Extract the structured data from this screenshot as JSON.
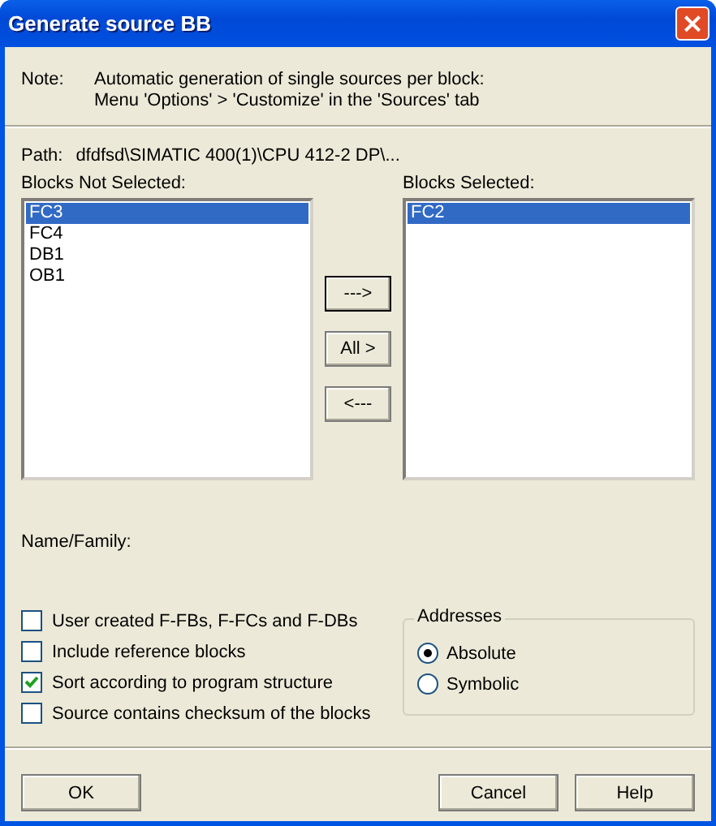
{
  "window": {
    "title": "Generate source BB",
    "close": "×"
  },
  "note": {
    "label": "Note:",
    "lines": [
      "Automatic generation of single sources per block:",
      "Menu 'Options' > 'Customize' in the 'Sources' tab"
    ]
  },
  "path": {
    "label": "Path:",
    "value": "dfdfsd\\SIMATIC 400(1)\\CPU 412-2 DP\\..."
  },
  "blocks_not_selected": {
    "label": "Blocks Not Selected:",
    "items": [
      {
        "text": "FC3",
        "selected": true
      },
      {
        "text": "FC4",
        "selected": false
      },
      {
        "text": "DB1",
        "selected": false
      },
      {
        "text": "OB1",
        "selected": false
      }
    ]
  },
  "move_buttons": [
    {
      "label": "--->",
      "default": true
    },
    {
      "label": "All >",
      "default": false
    },
    {
      "label": "<---",
      "default": false
    }
  ],
  "blocks_selected": {
    "label": "Blocks Selected:",
    "items": [
      {
        "text": "FC2",
        "selected": true
      }
    ]
  },
  "name_family": {
    "label": "Name/Family:"
  },
  "options": [
    {
      "label": "User created F-FBs, F-FCs and F-DBs",
      "checked": false
    },
    {
      "label": "Include reference blocks",
      "checked": false
    },
    {
      "label": "Sort according to program structure",
      "checked": true
    },
    {
      "label": "Source contains checksum of the blocks",
      "checked": false
    }
  ],
  "addresses": {
    "title": "Addresses",
    "options": [
      {
        "label": "Absolute",
        "selected": true
      },
      {
        "label": "Symbolic",
        "selected": false
      }
    ]
  },
  "buttons": [
    "OK",
    "Cancel",
    "Help"
  ]
}
